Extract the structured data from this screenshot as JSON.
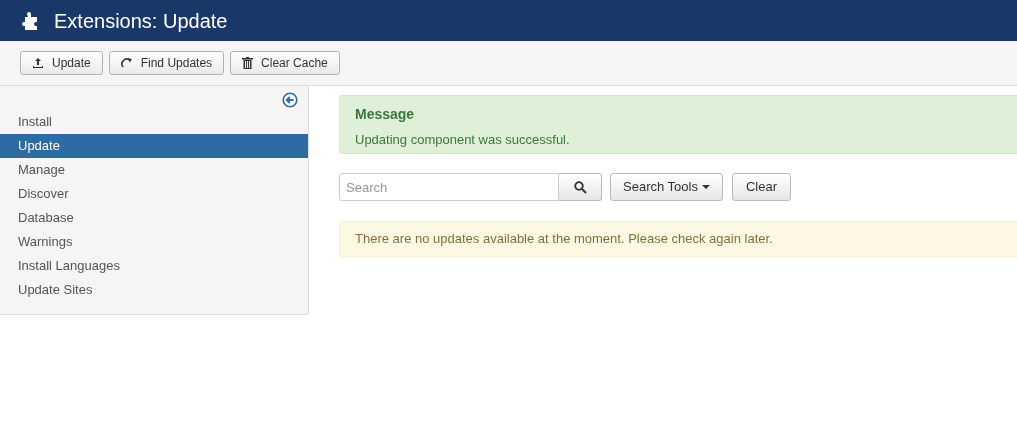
{
  "header": {
    "title": "Extensions: Update"
  },
  "toolbar": [
    {
      "label": "Update",
      "kind": "upload"
    },
    {
      "label": "Find Updates",
      "kind": "refresh"
    },
    {
      "label": "Clear Cache",
      "kind": "trash"
    }
  ],
  "sidebar": {
    "items": [
      {
        "label": "Install",
        "selected": false
      },
      {
        "label": "Update",
        "selected": true
      },
      {
        "label": "Manage",
        "selected": false
      },
      {
        "label": "Discover",
        "selected": false
      },
      {
        "label": "Database",
        "selected": false
      },
      {
        "label": "Warnings",
        "selected": false
      },
      {
        "label": "Install Languages",
        "selected": false
      },
      {
        "label": "Update Sites",
        "selected": false
      }
    ]
  },
  "message": {
    "heading": "Message",
    "text": "Updating component was successful."
  },
  "filters": {
    "search_placeholder": "Search",
    "search_tools": "Search Tools",
    "clear": "Clear"
  },
  "notice": "There are no updates available at the moment. Please check again later."
}
